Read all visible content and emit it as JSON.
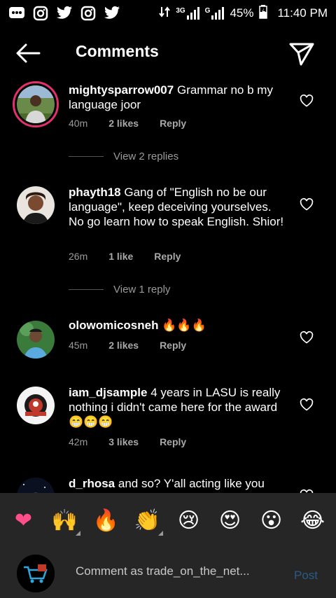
{
  "status_bar": {
    "network": "3G",
    "battery": "45%",
    "time": "11:40 PM"
  },
  "header": {
    "title": "Comments"
  },
  "comments": [
    {
      "username": "mightysparrow007",
      "text": "Grammar no b my language joor",
      "time": "40m",
      "likes": "2 likes",
      "reply": "Reply",
      "view_replies": "View 2 replies"
    },
    {
      "username": "phayth18",
      "text": "Gang of \"English no be our language\", keep deceiving yourselves. No go learn how to speak English. Shior!",
      "time": "26m",
      "likes": "1 like",
      "reply": "Reply",
      "view_replies": "View 1 reply"
    },
    {
      "username": "olowomicosneh",
      "text": "🔥🔥🔥",
      "time": "45m",
      "likes": "2 likes",
      "reply": "Reply"
    },
    {
      "username": "iam_djsample",
      "text": "4 years in LASU is really nothing i didn't came here for the award 😁😁😁",
      "time": "42m",
      "likes": "3 likes",
      "reply": "Reply"
    },
    {
      "username": "d_rhosa",
      "text": "and so? Y'all acting like you"
    }
  ],
  "emoji_bar": [
    "❤",
    "🙌",
    "🔥",
    "👏",
    "😢",
    "😍",
    "😮",
    "😂"
  ],
  "input": {
    "placeholder": "Comment as trade_on_the_net...",
    "post_label": "Post"
  },
  "colors": {
    "background": "#000000",
    "panel": "#262626",
    "story_ring": "#e1306c",
    "post_disabled": "#2a5a85",
    "muted_text": "#9a9a9a"
  }
}
